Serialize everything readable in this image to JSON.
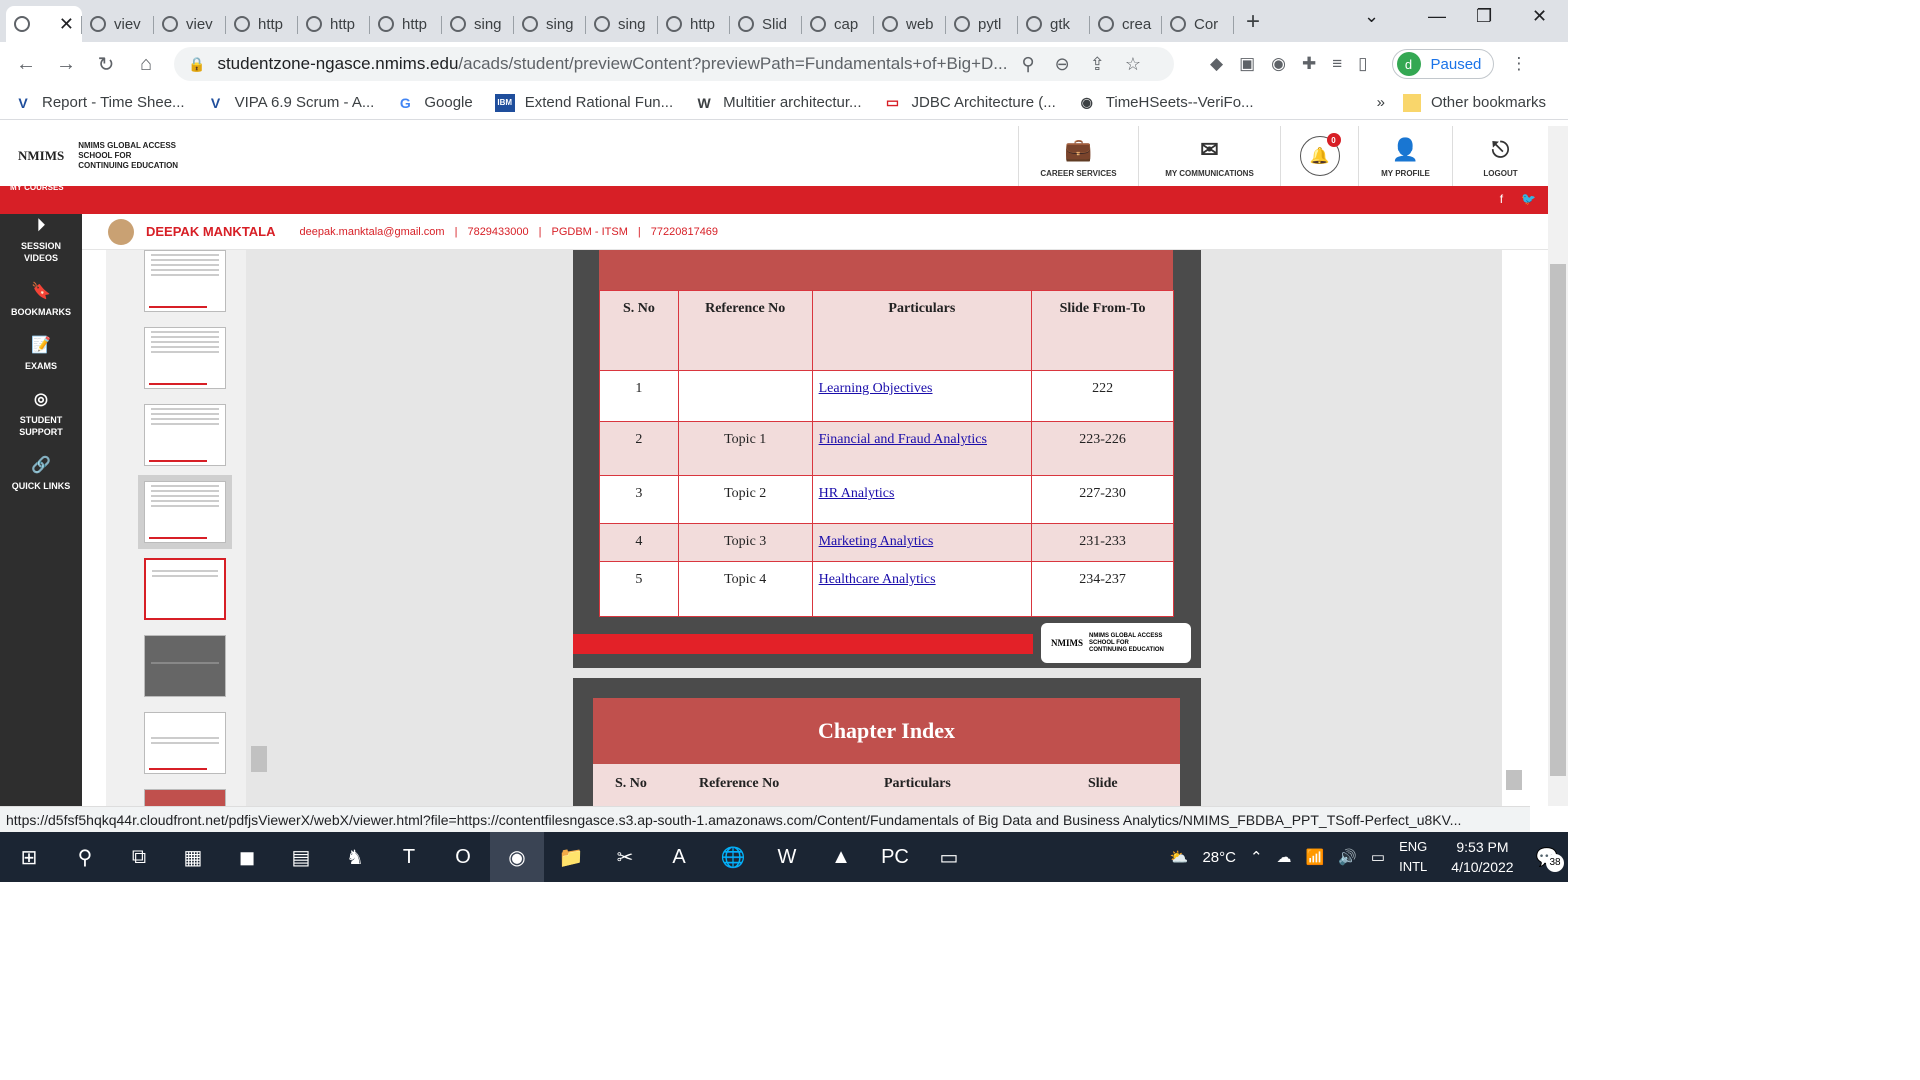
{
  "browser": {
    "tabs": [
      {
        "label": "viev"
      },
      {
        "label": "viev"
      },
      {
        "label": "http"
      },
      {
        "label": "http"
      },
      {
        "label": "http"
      },
      {
        "label": "sing"
      },
      {
        "label": "sing"
      },
      {
        "label": "sing"
      },
      {
        "label": "http"
      },
      {
        "label": "Slid"
      },
      {
        "label": "cap"
      },
      {
        "label": "web"
      },
      {
        "label": "pytl"
      },
      {
        "label": "gtk"
      },
      {
        "label": "crea"
      },
      {
        "label": "Cor"
      }
    ],
    "url_host": "studentzone-ngasce.nmims.edu",
    "url_path": "/acads/student/previewContent?previewPath=Fundamentals+of+Big+D...",
    "profile_initial": "d",
    "profile_status": "Paused",
    "bookmarks": [
      "Report - Time Shee...",
      "VIPA 6.9 Scrum - A...",
      "Google",
      "Extend Rational Fun...",
      "Multitier architectur...",
      "JDBC Architecture (...",
      "TimeHSeets--VeriFo..."
    ],
    "other_bookmarks": "Other bookmarks"
  },
  "site": {
    "logo_mark": "NMIMS",
    "logo_lines": [
      "NMIMS GLOBAL ACCESS",
      "SCHOOL FOR",
      "CONTINUING EDUCATION"
    ],
    "nav": [
      "CAREER SERVICES",
      "MY COMMUNICATIONS",
      "MY PROFILE",
      "LOGOUT"
    ],
    "notif_count": "0",
    "my_courses": "MY COURSES",
    "user": {
      "name": "DEEPAK MANKTALA",
      "email": "deepak.manktala@gmail.com",
      "phone": "7829433000",
      "program": "PGDBM - ITSM",
      "id": "77220817469"
    },
    "sidebar": [
      {
        "l1": "SESSION",
        "l2": "VIDEOS"
      },
      {
        "l1": "BOOKMARKS",
        "l2": ""
      },
      {
        "l1": "EXAMS",
        "l2": ""
      },
      {
        "l1": "STUDENT",
        "l2": "SUPPORT"
      },
      {
        "l1": "QUICK LINKS",
        "l2": ""
      }
    ]
  },
  "slide": {
    "headers": [
      "S. No",
      "Reference No",
      "Particulars",
      "Slide From-To"
    ],
    "rows": [
      {
        "sno": "1",
        "ref": "",
        "part": "Learning Objectives",
        "slides": "222"
      },
      {
        "sno": "2",
        "ref": "Topic 1",
        "part": "Financial and Fraud Analytics",
        "slides": "223-226"
      },
      {
        "sno": "3",
        "ref": "Topic 2",
        "part": "HR Analytics",
        "slides": "227-230"
      },
      {
        "sno": "4",
        "ref": "Topic 3",
        "part": "Marketing Analytics",
        "slides": "231-233"
      },
      {
        "sno": "5",
        "ref": "Topic 4",
        "part": "Healthcare Analytics",
        "slides": "234-237"
      }
    ],
    "next_title": "Chapter Index",
    "next_headers": [
      "S. No",
      "Reference No",
      "Particulars",
      "Slide"
    ]
  },
  "status_url": "https://d5fsf5hqkq44r.cloudfront.net/pdfjsViewerX/webX/viewer.html?file=https://contentfilesngasce.s3.ap-south-1.amazonaws.com/Content/Fundamentals of Big Data and Business Analytics/NMIMS_FBDBA_PPT_TSoff-Perfect_u8KV...",
  "taskbar": {
    "temp": "28°C",
    "lang1": "ENG",
    "lang2": "INTL",
    "time": "9:53 PM",
    "date": "4/10/2022",
    "notif": "38"
  }
}
